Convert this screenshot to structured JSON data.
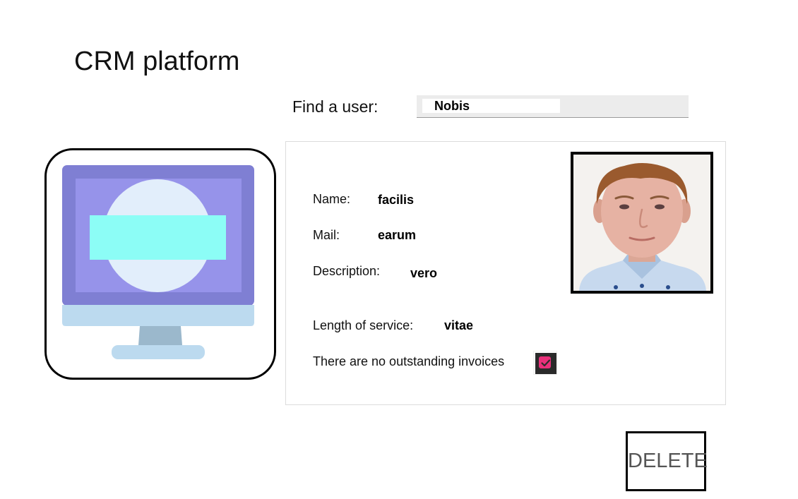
{
  "app": {
    "title": "CRM platform"
  },
  "search": {
    "label": "Find a user:",
    "value": "Nobis",
    "placeholder": ""
  },
  "user": {
    "name_label": "Name:",
    "name_value": "facilis",
    "mail_label": "Mail:",
    "mail_value": "earum",
    "description_label": "Description:",
    "description_value": "vero",
    "service_label": "Length of service:",
    "service_value": "vitae",
    "invoices_label": "There are no outstanding invoices",
    "invoices_checked": true
  },
  "actions": {
    "delete_label": "DELETE"
  },
  "icons": {
    "app_logo": "monitor-icon",
    "checkbox": "checkmark-icon",
    "photo": "user-photo"
  },
  "colors": {
    "checkbox_accent": "#e8307a",
    "monitor_frame": "#7f7fd3",
    "monitor_screen": "#9693ea",
    "monitor_bar": "#8cfdf6"
  }
}
